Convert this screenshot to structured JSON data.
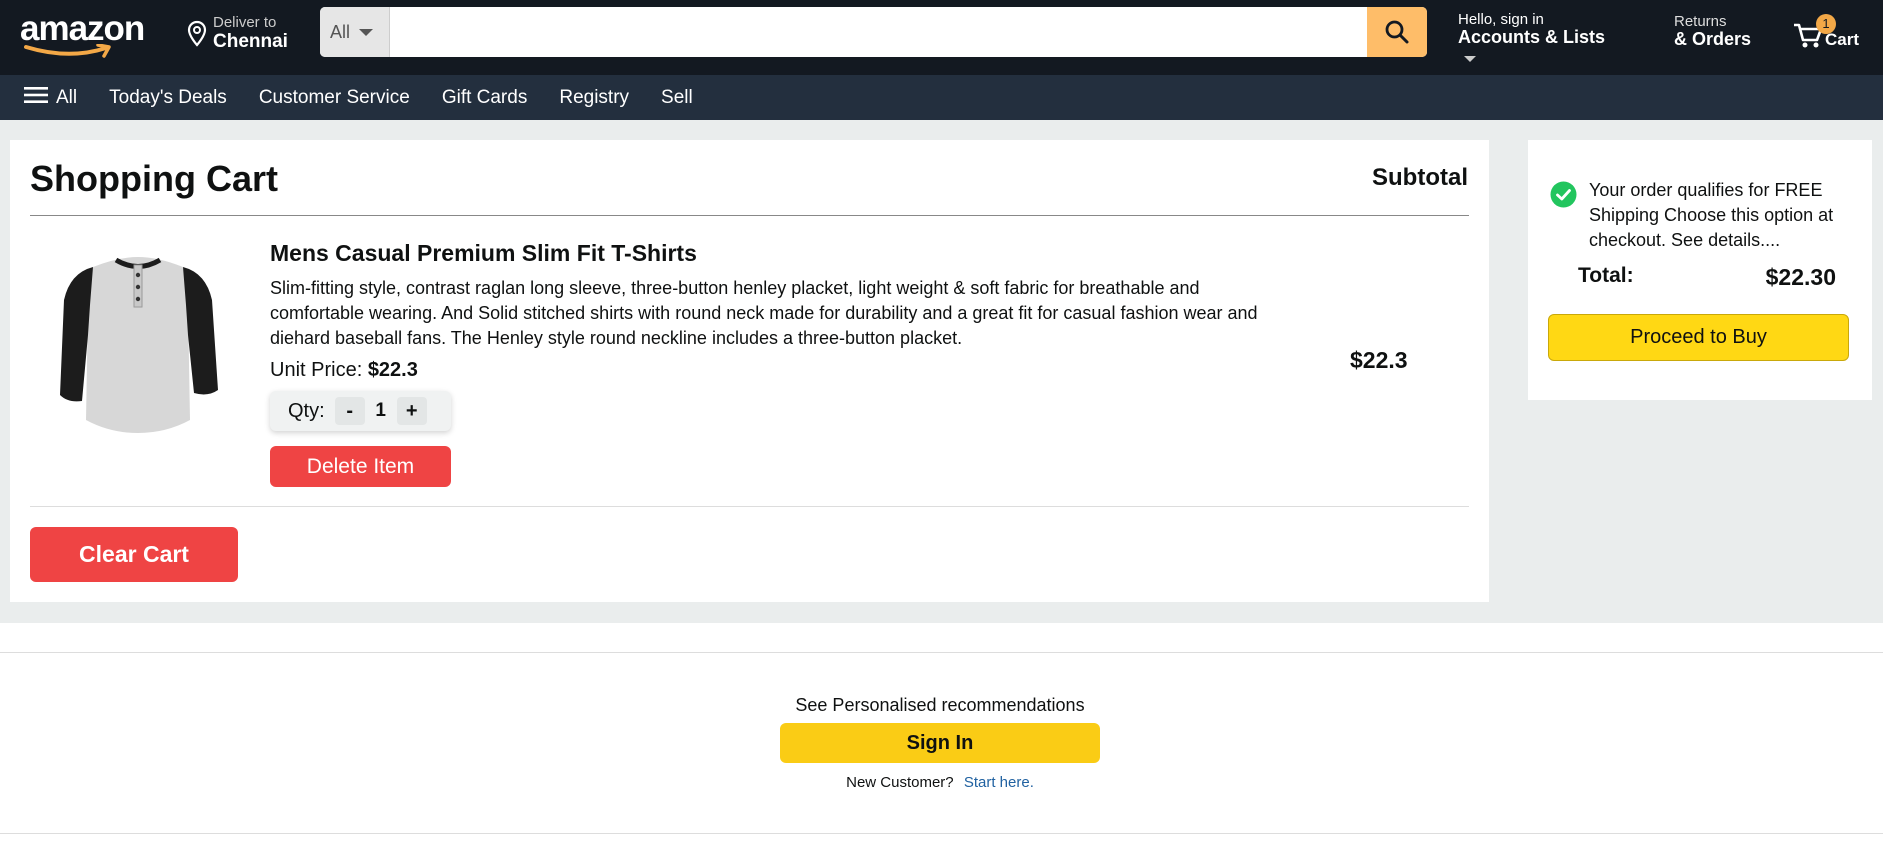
{
  "header": {
    "logo_text": "amazon",
    "deliver_to": "Deliver to",
    "location": "Chennai",
    "search_category": "All",
    "search_placeholder": "",
    "account_greeting": "Hello, sign in",
    "account_label": "Accounts & Lists",
    "returns_label": "Returns",
    "orders_label": "& Orders",
    "cart_count": "1",
    "cart_label": "Cart"
  },
  "subnav": {
    "menu_label": "All",
    "items": [
      "Today's Deals",
      "Customer Service",
      "Gift Cards",
      "Registry",
      "Sell"
    ]
  },
  "cart": {
    "title": "Shopping Cart",
    "subtotal_heading": "Subtotal",
    "items": [
      {
        "name": "Mens Casual Premium Slim Fit T-Shirts",
        "description": "Slim-fitting style, contrast raglan long sleeve, three-button henley placket, light weight & soft fabric for breathable and comfortable wearing. And Solid stitched shirts with round neck made for durability and a great fit for casual fashion wear and diehard baseball fans. The Henley style round neckline includes a three-button placket.",
        "unit_price_label": "Unit Price:",
        "unit_price": "$22.3",
        "qty_label": "Qty:",
        "qty_minus": "-",
        "qty": "1",
        "qty_plus": "+",
        "delete_label": "Delete Item",
        "line_total": "$22.3"
      }
    ],
    "clear_label": "Clear Cart"
  },
  "summary": {
    "message": "Your order qualifies for FREE Shipping Choose this option at checkout. See details....",
    "total_label": "Total:",
    "total_value": "$22.30",
    "buy_label": "Proceed to Buy"
  },
  "recommend": {
    "text": "See Personalised recommendations",
    "signin_label": "Sign In",
    "new_customer": "New Customer?",
    "start_here": "Start here."
  },
  "colors": {
    "header_bg": "#131921",
    "subnav_bg": "#232f3e",
    "search_btn": "#febd69",
    "danger": "#ef4444",
    "buy_yellow": "#ffd814",
    "signin_yellow": "#facc15",
    "check_green": "#22c55e",
    "link_blue": "#2162a1"
  }
}
